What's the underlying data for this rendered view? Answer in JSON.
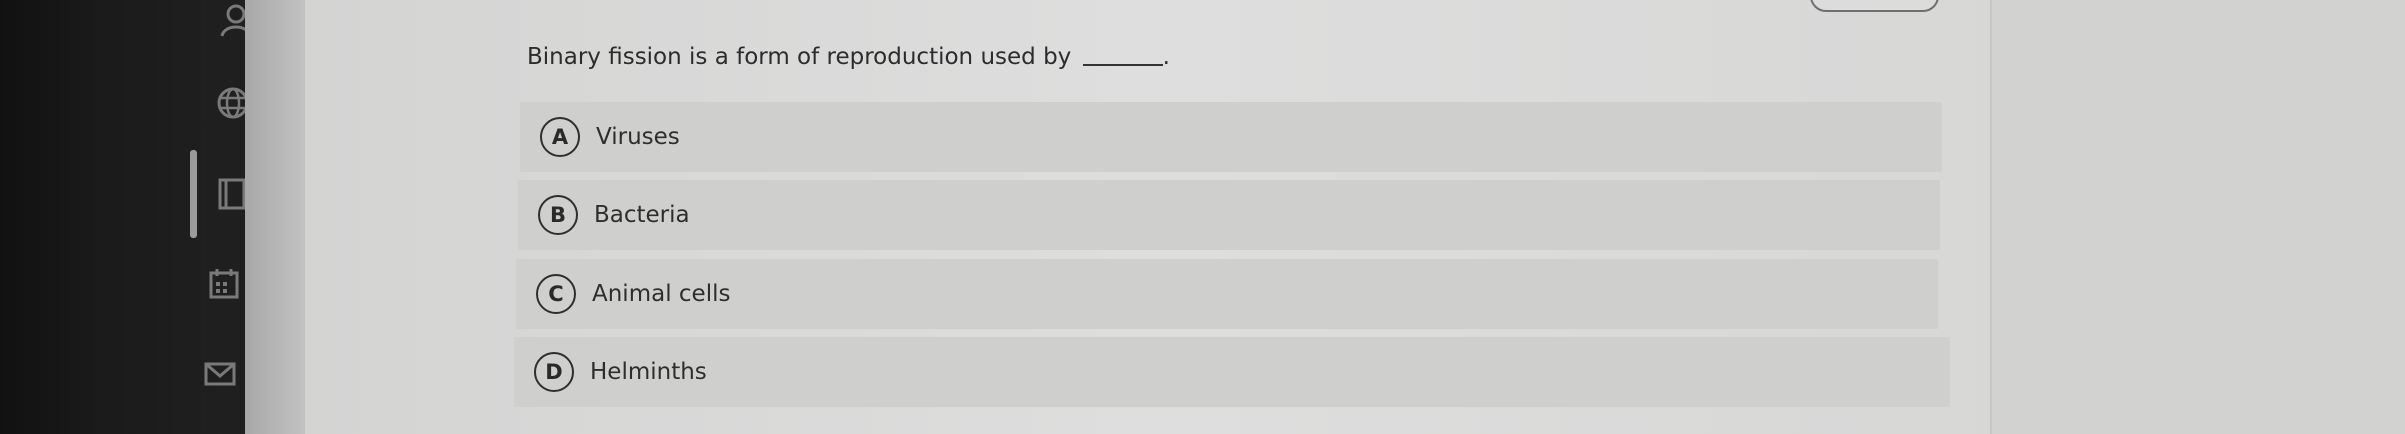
{
  "question": {
    "text": "Binary fission is a form of reproduction used by",
    "blank_suffix": "."
  },
  "options": [
    {
      "letter": "A",
      "label": "Viruses"
    },
    {
      "letter": "B",
      "label": "Bacteria"
    },
    {
      "letter": "C",
      "label": "Animal cells"
    },
    {
      "letter": "D",
      "label": "Helminths"
    }
  ],
  "sidebar": {
    "icons": [
      "user-icon",
      "globe-icon",
      "book-icon",
      "calendar-icon",
      "mail-icon"
    ]
  },
  "colors": {
    "background": "#d9d9d8",
    "option_background": "#cfcfce",
    "text": "#2c2c2c",
    "sidebar": "#1a1a1a"
  }
}
